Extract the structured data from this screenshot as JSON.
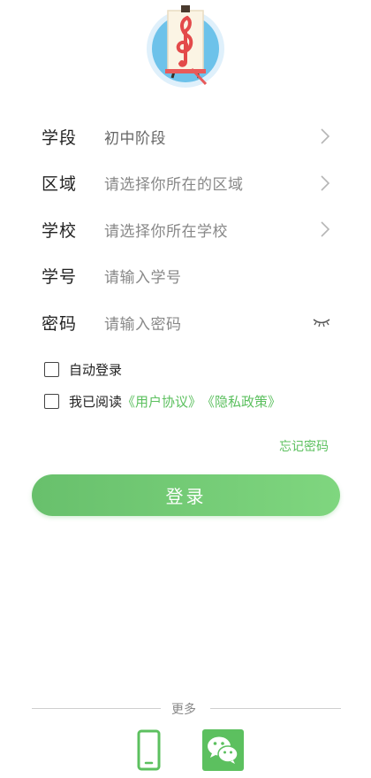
{
  "form": {
    "stage": {
      "label": "学段",
      "value": "初中阶段"
    },
    "region": {
      "label": "区域",
      "placeholder": "请选择你所在的区域"
    },
    "school": {
      "label": "学校",
      "placeholder": "请选择你所在学校"
    },
    "student_id": {
      "label": "学号",
      "placeholder": "请输入学号"
    },
    "password": {
      "label": "密码",
      "placeholder": "请输入密码"
    }
  },
  "options": {
    "auto_login": "自动登录",
    "agree_prefix": "我已阅读",
    "user_agreement": "《用户协议》",
    "privacy_policy": "《隐私政策》"
  },
  "forgot_password": "忘记密码",
  "login_button": "登录",
  "more_label": "更多",
  "icons": {
    "logo": "music-easel-logo",
    "chevron": "chevron-right-icon",
    "eye": "eye-closed-icon",
    "phone": "phone-icon",
    "wechat": "wechat-icon"
  },
  "colors": {
    "accent": "#5cc05f",
    "button_start": "#68c06c",
    "button_end": "#7fd67f",
    "wechat": "#5cc05f"
  }
}
